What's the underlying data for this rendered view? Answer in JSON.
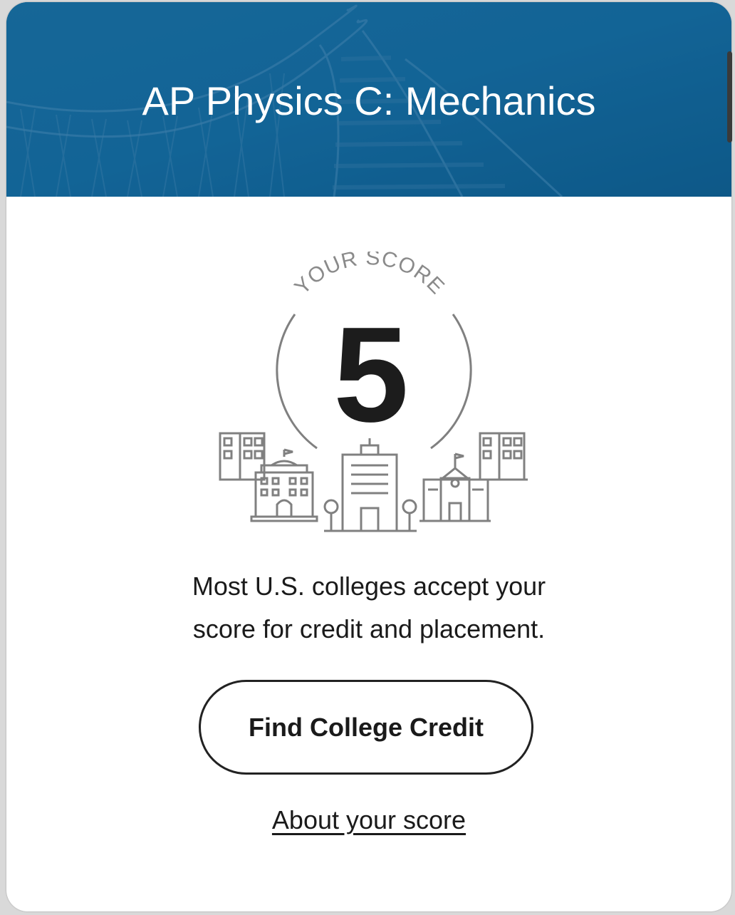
{
  "header": {
    "title": "AP Physics C: Mechanics",
    "background_color": "#0f5f8f",
    "background_image": "roller-coaster-track"
  },
  "score_badge": {
    "arc_label": "YOUR SCORE",
    "score": "5",
    "illustration": "college-buildings-icon"
  },
  "message": {
    "line1": "Most U.S. colleges accept your",
    "line2": "score for credit and placement."
  },
  "actions": {
    "primary_label": "Find College Credit",
    "link_label": "About your score"
  },
  "colors": {
    "text": "#1a1a1a",
    "line_art": "#808080"
  }
}
